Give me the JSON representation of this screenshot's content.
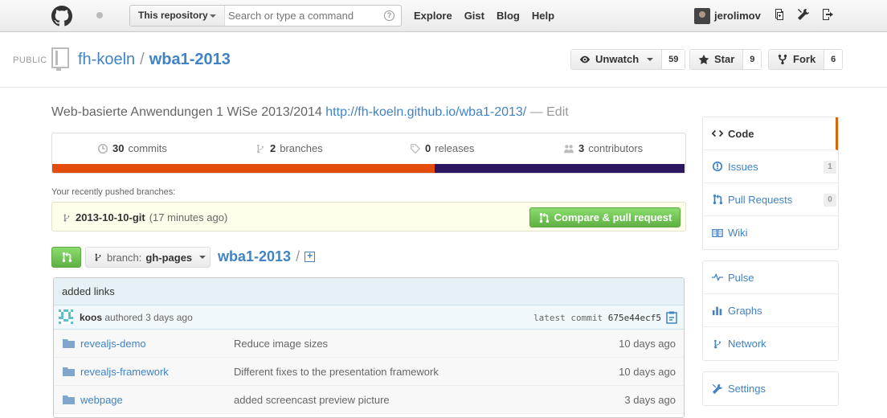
{
  "header": {
    "scope_label": "This repository",
    "search_placeholder": "Search or type a command",
    "search_help": "?",
    "nav": [
      "Explore",
      "Gist",
      "Blog",
      "Help"
    ],
    "username": "jerolimov"
  },
  "repo": {
    "visibility": "PUBLIC",
    "owner": "fh-koeln",
    "separator": "/",
    "name": "wba1-2013",
    "unwatch_label": "Unwatch",
    "watch_count": "59",
    "star_label": "Star",
    "star_count": "9",
    "fork_label": "Fork",
    "fork_count": "6"
  },
  "description": {
    "text": "Web-basierte Anwendungen 1 WiSe 2013/2014",
    "url": "http://fh-koeln.github.io/wba1-2013/",
    "edit": "— Edit"
  },
  "numbers": {
    "commits_count": "30",
    "commits_label": "commits",
    "branches_count": "2",
    "branches_label": "branches",
    "releases_count": "0",
    "releases_label": "releases",
    "contributors_count": "3",
    "contributors_label": "contributors"
  },
  "language_colors": [
    "#e34c0a",
    "#2b1660"
  ],
  "recent": {
    "label": "Your recently pushed branches:",
    "branch": "2013-10-10-git",
    "time": "(17 minutes ago)",
    "compare_label": "Compare & pull request"
  },
  "file_nav": {
    "branch_prefix": "branch:",
    "branch_name": "gh-pages",
    "breadcrumb_repo": "wba1-2013",
    "breadcrumb_slash": "/"
  },
  "commit": {
    "message": "added links",
    "author": "koos",
    "authored": "authored 3 days ago",
    "latest_label": "latest commit",
    "sha": "675e44ecf5"
  },
  "files": [
    {
      "name": "revealjs-demo",
      "message": "Reduce image sizes",
      "age": "10 days ago"
    },
    {
      "name": "revealjs-framework",
      "message": "Different fixes to the presentation framework",
      "age": "10 days ago"
    },
    {
      "name": "webpage",
      "message": "added screencast preview picture",
      "age": "3 days ago"
    }
  ],
  "sidebar": {
    "code": "Code",
    "issues": "Issues",
    "issues_count": "1",
    "pulls": "Pull Requests",
    "pulls_count": "0",
    "wiki": "Wiki",
    "pulse": "Pulse",
    "graphs": "Graphs",
    "network": "Network",
    "settings": "Settings"
  }
}
